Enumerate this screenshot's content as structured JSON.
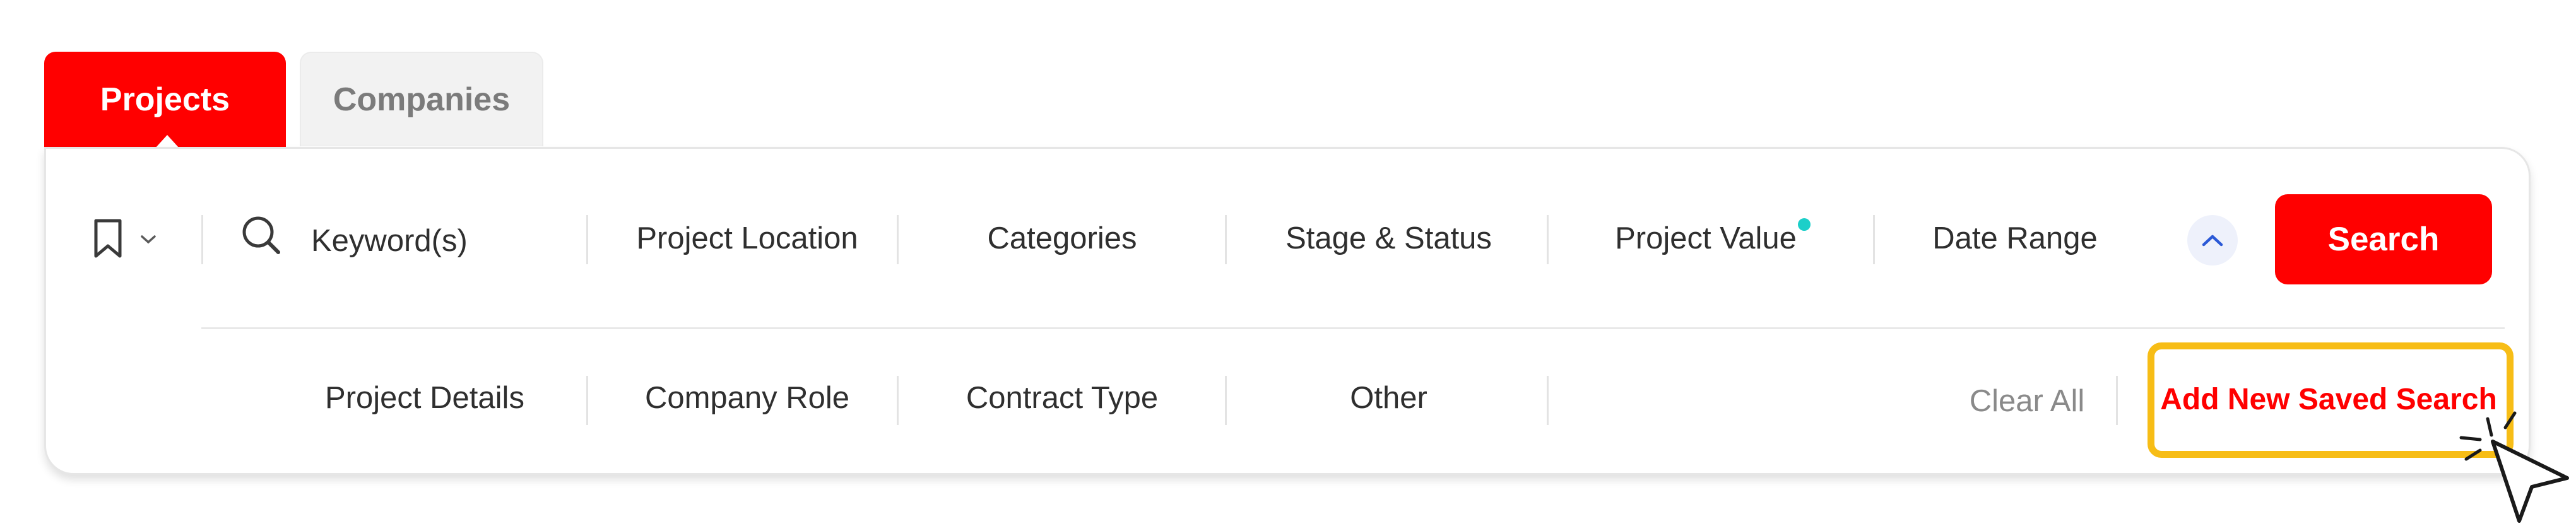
{
  "tabs": [
    {
      "label": "Projects",
      "active": true
    },
    {
      "label": "Companies",
      "active": false
    }
  ],
  "search_bar": {
    "keyword_label": "Keyword(s)",
    "filters_row1": [
      "Project Location",
      "Categories",
      "Stage & Status",
      "Project Value",
      "Date Range"
    ],
    "search_button": "Search",
    "project_value_indicator_color": "#1ccfc9"
  },
  "filters_row2": [
    "Project Details",
    "Company Role",
    "Contract Type",
    "Other"
  ],
  "actions": {
    "clear_all": "Clear All",
    "add_saved_search": "Add New Saved Search"
  },
  "colors": {
    "brand_red": "#ff0000",
    "highlight_yellow": "#f7bd16",
    "collapse_blue": "#2b59d6"
  },
  "icons": [
    "bookmark-icon",
    "chevron-down-icon",
    "search-icon",
    "chevron-up-icon",
    "pointer-cursor-icon"
  ]
}
